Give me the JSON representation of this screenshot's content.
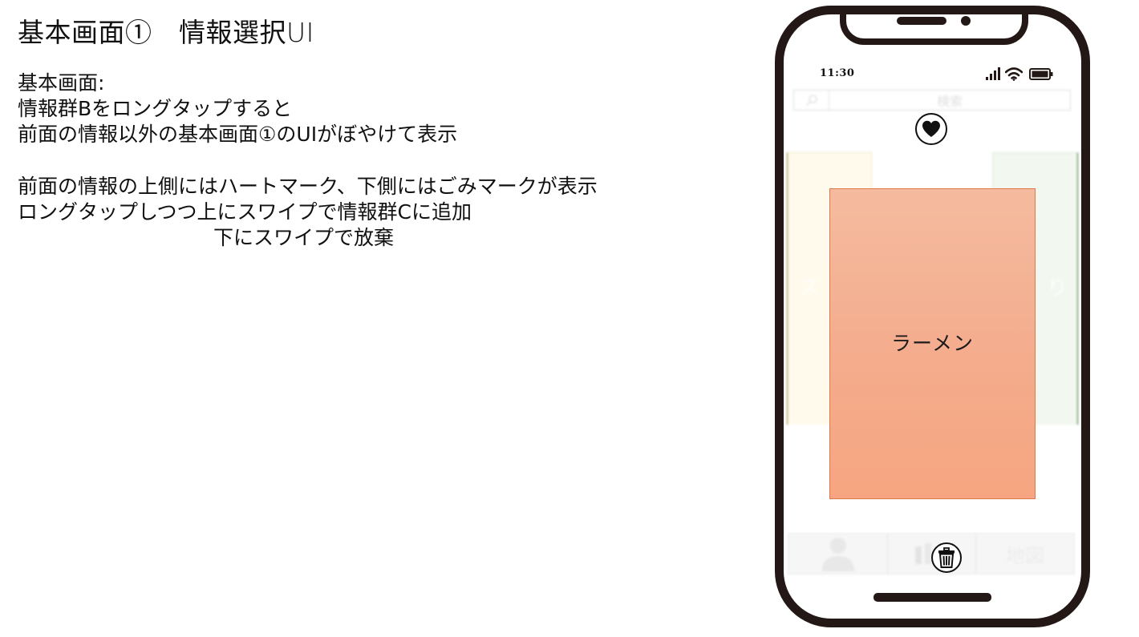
{
  "slide": {
    "title": "基本画面①　情報選択UI",
    "description_1": [
      "基本画面:",
      "情報群Bをロングタップすると",
      "前面の情報以外の基本画面①のUIがぼやけて表示"
    ],
    "description_2": [
      "前面の情報の上側にはハートマーク、下側にはごみマークが表示",
      "ロングタップしつつ上にスワイプで情報群Cに追加",
      "下にスワイプで放棄"
    ]
  },
  "phone": {
    "status_bar": {
      "time": "11:30",
      "icons": [
        "signal-icon",
        "wifi-icon",
        "battery-icon"
      ]
    },
    "search": {
      "placeholder": "検索",
      "icon": "search-icon"
    },
    "favorite_icon": "heart-icon",
    "background_cards": {
      "left_text": "ス",
      "right_text": "り",
      "left_color": "#fffaeb",
      "right_color": "#f2f7ef"
    },
    "focused_card": {
      "label": "ラーメン",
      "color_top": "#f5bb9f",
      "color_bottom": "#f6a580",
      "border_color": "#e0794a"
    },
    "delete_icon": "trash-icon",
    "bottom_nav": {
      "items": [
        {
          "icon": "person-icon",
          "label": ""
        },
        {
          "icon": "list-icon",
          "label": ""
        },
        {
          "icon": "",
          "label": "地図"
        }
      ]
    }
  },
  "colors": {
    "phone_frame": "#231815",
    "text": "#111111"
  }
}
